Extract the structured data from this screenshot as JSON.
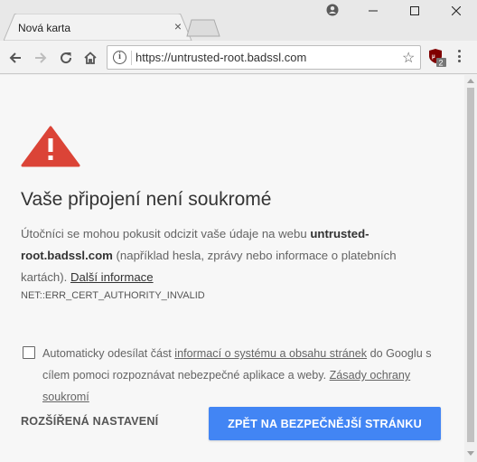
{
  "tab": {
    "title": "Nová karta",
    "close": "×"
  },
  "address_bar": {
    "url": "https://untrusted-root.badssl.com"
  },
  "extension": {
    "badge": "2"
  },
  "colors": {
    "accent": "#4285f4",
    "warning": "#db4437"
  },
  "page": {
    "heading": "Vaše připojení není soukromé",
    "intro_before": "Útočníci se mohou pokusit odcizit vaše údaje na webu ",
    "site": "untrusted-root.badssl.com",
    "intro_after": " (například hesla, zprávy nebo informace o platebních kartách). ",
    "more_link": "Další informace",
    "error_code": "NET::ERR_CERT_AUTHORITY_INVALID",
    "optin_before": "Automaticky odesílat část ",
    "optin_link": "informací o systému a obsahu stránek",
    "optin_middle": " do Googlu s cílem pomoci rozpoznávat nebezpečné aplikace a weby. ",
    "optin_policy": "Zásady ochrany soukromí",
    "advanced_button": "ROZŠÍŘENÁ NASTAVENÍ",
    "back_button": "ZPĚT NA BEZPEČNĚJŠÍ STRÁNKU"
  }
}
